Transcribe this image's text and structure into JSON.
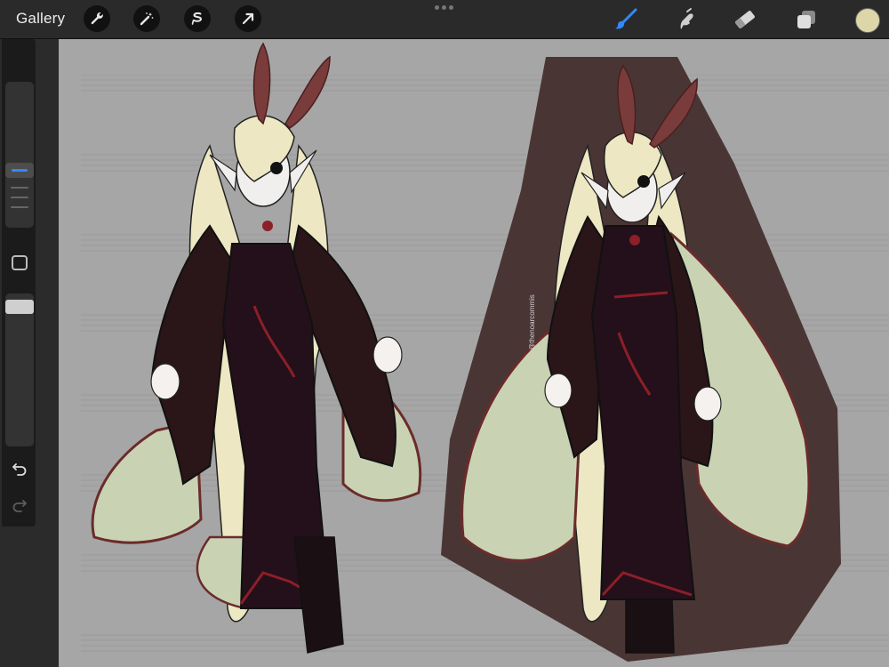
{
  "app": {
    "gallery_label": "Gallery",
    "left_tools": [
      "wrench-icon",
      "magic-wand-icon",
      "selection-icon",
      "transform-arrow-icon"
    ],
    "right_tools": [
      "brush-icon",
      "smudge-icon",
      "eraser-icon",
      "layers-icon"
    ],
    "active_tool": "brush-icon",
    "accent_color": "#2f89ff",
    "current_color": "#dcd6a8"
  },
  "sidebar": {
    "controls": [
      "brush-size-slider",
      "modify-button",
      "opacity-slider",
      "undo-button",
      "redo-button"
    ]
  },
  "canvas": {
    "background": "#a6a6a6",
    "artwork": {
      "panel_color": "#4a3535",
      "signature": "@thenoarcommis"
    }
  }
}
